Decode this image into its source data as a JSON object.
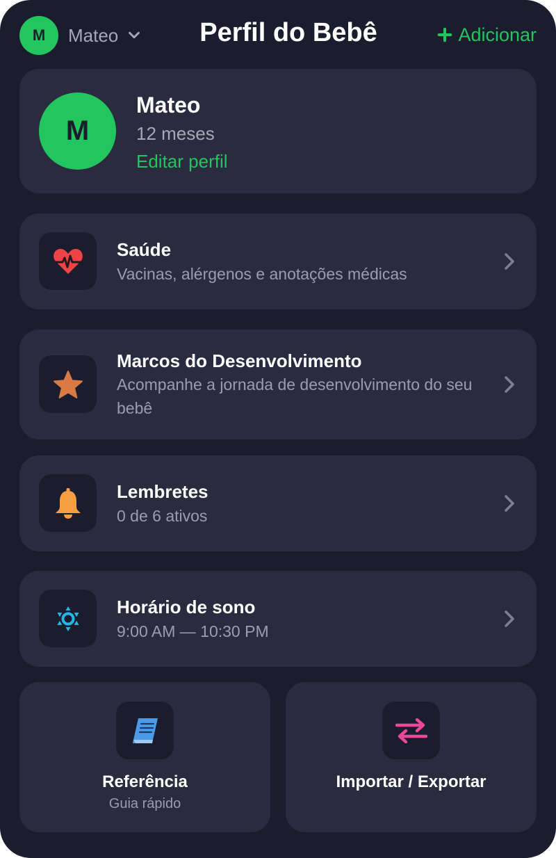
{
  "header": {
    "current_baby_initial": "M",
    "current_baby_name": "Mateo",
    "title": "Perfil do Bebê",
    "add_label": "Adicionar"
  },
  "profile": {
    "initial": "M",
    "name": "Mateo",
    "age": "12 meses",
    "edit_label": "Editar perfil"
  },
  "menu": [
    {
      "title": "Saúde",
      "subtitle": "Vacinas, alérgenos e anotações médicas",
      "icon": "heart-pulse-icon"
    },
    {
      "title": "Marcos do Desenvolvimento",
      "subtitle": "Acompanhe a jornada de desenvolvimento do seu bebê",
      "icon": "star-icon"
    },
    {
      "title": "Lembretes",
      "subtitle": "0 de 6 ativos",
      "icon": "bell-icon"
    },
    {
      "title": "Horário de sono",
      "subtitle": "9:00 AM — 10:30 PM",
      "icon": "sleep-schedule-icon"
    }
  ],
  "tiles": [
    {
      "title": "Referência",
      "subtitle": "Guia rápido",
      "icon": "book-icon"
    },
    {
      "title": "Importar / Exportar",
      "icon": "import-export-arrows-icon"
    }
  ],
  "colors": {
    "background": "#1b1c2e",
    "card": "#2a2b3e",
    "accent_green": "#22c55e",
    "heart_red": "#ef4444",
    "star_orange": "#d97a45",
    "bell_orange": "#f59e42",
    "sleep_cyan": "#22b8e8",
    "book_blue": "#4a9be8",
    "arrows_pink": "#ec4899"
  }
}
